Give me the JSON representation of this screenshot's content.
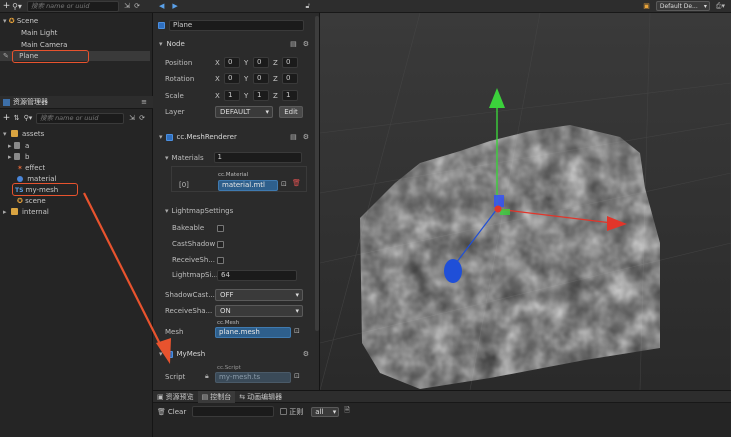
{
  "hierarchy": {
    "search_placeholder": "搜索 name or uuid",
    "scene": "Scene",
    "items": [
      "Main Light",
      "Main Camera",
      "Plane"
    ]
  },
  "assets": {
    "title": "资源管理器",
    "search_placeholder": "搜索 name or uuid",
    "root": "assets",
    "items": [
      "a",
      "b",
      "effect",
      "material",
      "my-mesh",
      "scene",
      "internal"
    ],
    "ts_badge": "TS"
  },
  "topbar": {
    "dropdown": "Default De..."
  },
  "inspector": {
    "node_name": "Plane",
    "node_section": "Node",
    "position_label": "Position",
    "rotation_label": "Rotation",
    "scale_label": "Scale",
    "layer_label": "Layer",
    "axis_x": "X",
    "axis_y": "Y",
    "axis_z": "Z",
    "position": [
      "0",
      "0",
      "0"
    ],
    "rotation": [
      "0",
      "0",
      "0"
    ],
    "scale": [
      "1",
      "1",
      "1"
    ],
    "layer_value": "DEFAULT",
    "edit_label": "Edit",
    "mesh_renderer": "cc.MeshRenderer",
    "materials_label": "Materials",
    "materials_count": "1",
    "material_index": "[0]",
    "material_type": "cc.Material",
    "material_value": "material.mtl",
    "lightmap_section": "LightmapSettings",
    "bakeable": "Bakeable",
    "cast_shadow": "CastShadow",
    "receive_shadow": "ReceiveSh...",
    "lightmap_size_label": "LightmapSi...",
    "lightmap_size": "64",
    "shadow_casting_label": "ShadowCast...",
    "shadow_casting_value": "OFF",
    "receive_shadow2_label": "ReceiveSha...",
    "receive_shadow2_value": "ON",
    "mesh_label": "Mesh",
    "mesh_type": "cc.Mesh",
    "mesh_value": "plane.mesh",
    "my_mesh": "MyMesh",
    "script_label": "Script",
    "script_type": "cc.Script",
    "script_value": "my-mesh.ts"
  },
  "console": {
    "tabs": [
      "资源预览",
      "控制台",
      "动画编辑器"
    ],
    "clear": "Clear",
    "regex": "正则",
    "filter": "all"
  },
  "colors": {
    "accent_blue": "#2f6fbf",
    "highlight_red": "#e8532e",
    "axis_x": "#e2352a",
    "axis_y": "#3bd13b",
    "axis_z": "#1f4fd8"
  }
}
